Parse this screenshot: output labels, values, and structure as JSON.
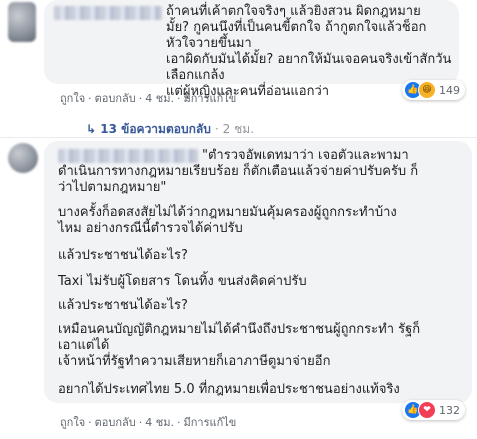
{
  "comment1": {
    "text": "ถ้าคนที่เค้าตกใจจริงๆ แล้วยิงสวน ผิดกฎหมาย\nมั้ย? กูคนนึงที่เป็นคนขี้ตกใจ ถ้ากูตกใจแล้วช็อก หัวใจวายขึ้นมา\nเอาผิดกับมันได้มั้ย? อยากให้มันเจอคนจริงเข้าสักวัน เลือกแกล้ง\nแต่ผู้หญิงและคนที่อ่อนแอกว่า",
    "like_label": "ถูกใจ",
    "reply_label": "ตอบกลับ",
    "time": "4 ชม.",
    "edited": "มีการแก้ไข",
    "reaction_count": "149"
  },
  "replies_link": {
    "label": "13 ข้อความตอบกลับ",
    "time": "2 ชม."
  },
  "comment2": {
    "quote": "\"ตำรวจอัพเดทมาว่า เจอตัวและพามา\nดำเนินการทางกฎหมายเรียบร้อย ก็ตักเตือนแล้วจ่ายค่าปรับครับ ก็\nว่าไปตามกฎหมาย\"",
    "p1": "บางครั้งก็อดสงสัยไม่ได้ว่ากฎหมายมันคุ้มครองผู้ถูกกระทำบ้าง\nไหม อย่างกรณีนี้ตำรวจได้ค่าปรับ",
    "p2": "แล้วประชาชนได้อะไร?",
    "p3": "Taxi ไม่รับผู้โดยสาร โดนทิ้ง ขนส่งคิดค่าปรับ",
    "p4": "แล้วประชาชนได้อะไร?",
    "p5": "เหมือนคนบัญญัติกฎหมายไม่ได้คำนึงถึงประชาชนผู้ถูกกระทำ รัฐก็\nเอาแต่ได้\nเจ้าหน้าที่รัฐทำความเสียหายก็เอาภาษีตูมาจ่ายอีก",
    "p6": "อยากได้ประเทศไทย 5.0 ที่กฎหมายเพื่อประชาชนอย่างแท้จริง",
    "like_label": "ถูกใจ",
    "reply_label": "ตอบกลับ",
    "time": "4 ชม.",
    "edited": "มีการแก้ไข",
    "reaction_count": "132"
  },
  "icons": {
    "like": "like-icon",
    "haha": "haha-icon",
    "love": "love-icon",
    "reply_arrow": "reply-arrow-icon"
  },
  "colors": {
    "link": "#385898",
    "bubble": "#f2f3f5",
    "like_blue": "#1877f2",
    "love_red": "#f33e58",
    "haha_yellow": "#f7b125"
  }
}
